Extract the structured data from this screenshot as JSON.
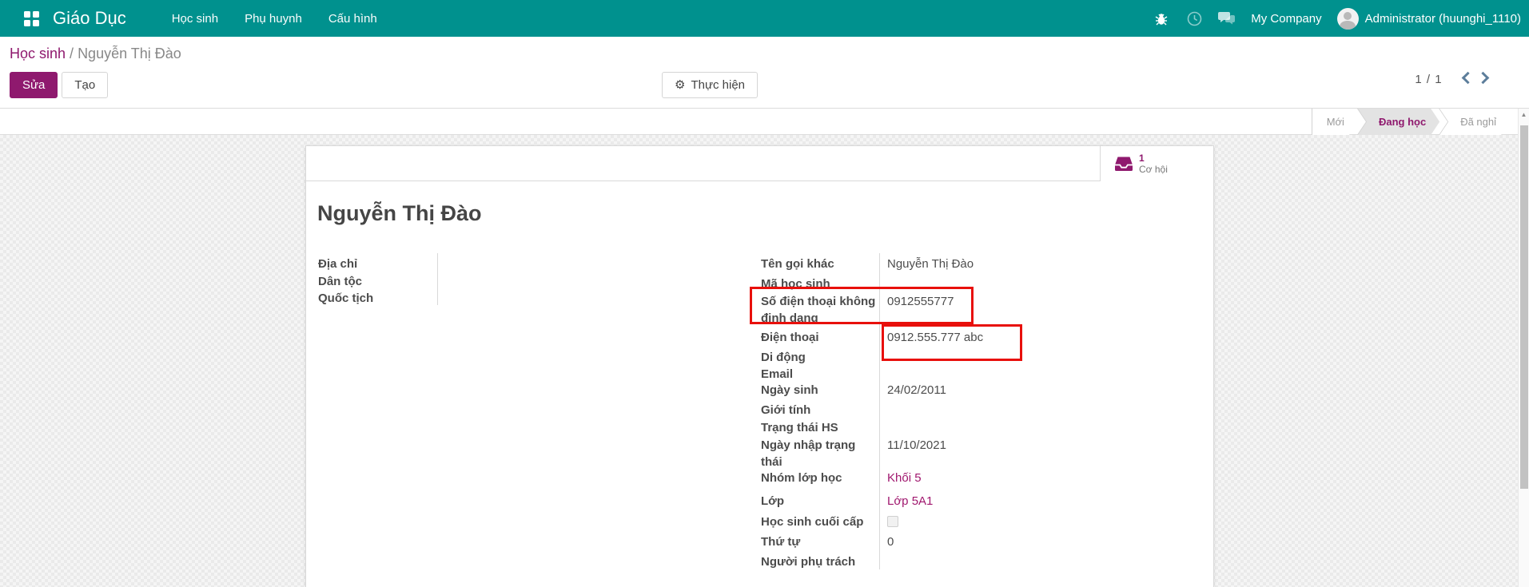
{
  "colors": {
    "navbar_teal": "#00918e",
    "accent_magenta": "#8f196e",
    "link_magenta": "#a0176e",
    "annotation_red": "#e8100c"
  },
  "navbar": {
    "brand": "Giáo Dục",
    "menu": [
      "Học sinh",
      "Phụ huynh",
      "Cấu hình"
    ],
    "company": "My Company",
    "user": "Administrator (huunghi_1110)",
    "icons": [
      "apps-grid-icon",
      "bug-icon",
      "clock-icon",
      "chat-icon",
      "avatar"
    ]
  },
  "breadcrumb": {
    "root": "Học sinh",
    "divider": "/",
    "current": "Nguyễn Thị Đào"
  },
  "control": {
    "edit": "Sửa",
    "create": "Tạo",
    "run": "Thực hiện",
    "pager": "1 / 1"
  },
  "statusbar": {
    "states": [
      {
        "label": "Mới",
        "active": false
      },
      {
        "label": "Đang học",
        "active": true
      },
      {
        "label": "Đã nghỉ",
        "active": false
      }
    ]
  },
  "sheet": {
    "button_box": {
      "count": "1",
      "label": "Cơ hội",
      "icon": "opportunity-tray-icon"
    },
    "title": "Nguyễn Thị Đào",
    "left_fields": [
      {
        "label": "Địa chỉ",
        "value": ""
      },
      {
        "label": "Dân tộc",
        "value": ""
      },
      {
        "label": "Quốc tịch",
        "value": ""
      }
    ],
    "right_fields": [
      {
        "label": "Tên gọi khác",
        "value": "Nguyễn Thị Đào"
      },
      {
        "label": "Mã học sinh",
        "value": ""
      },
      {
        "label": "Số điện thoại không định dạng",
        "value": "0912555777",
        "annotated": true
      },
      {
        "label": "Điện thoại",
        "value": "0912.555.777 abc",
        "annotated": true
      },
      {
        "label": "Di động",
        "value": ""
      },
      {
        "label": "Email",
        "value": ""
      },
      {
        "label": "Ngày sinh",
        "value": "24/02/2011"
      },
      {
        "label": "Giới tính",
        "value": ""
      },
      {
        "label": "Trạng thái HS",
        "value": ""
      },
      {
        "label": "Ngày nhập trạng thái",
        "value": "11/10/2021"
      },
      {
        "label": "Nhóm lớp học",
        "value": "Khối 5",
        "link": true
      },
      {
        "label": "Lớp",
        "value": "Lớp 5A1",
        "link": true
      },
      {
        "label": "Học sinh cuối cấp",
        "value": "",
        "checkbox": true
      },
      {
        "label": "Thứ tự",
        "value": "0"
      },
      {
        "label": "Người phụ trách",
        "value": ""
      }
    ]
  }
}
